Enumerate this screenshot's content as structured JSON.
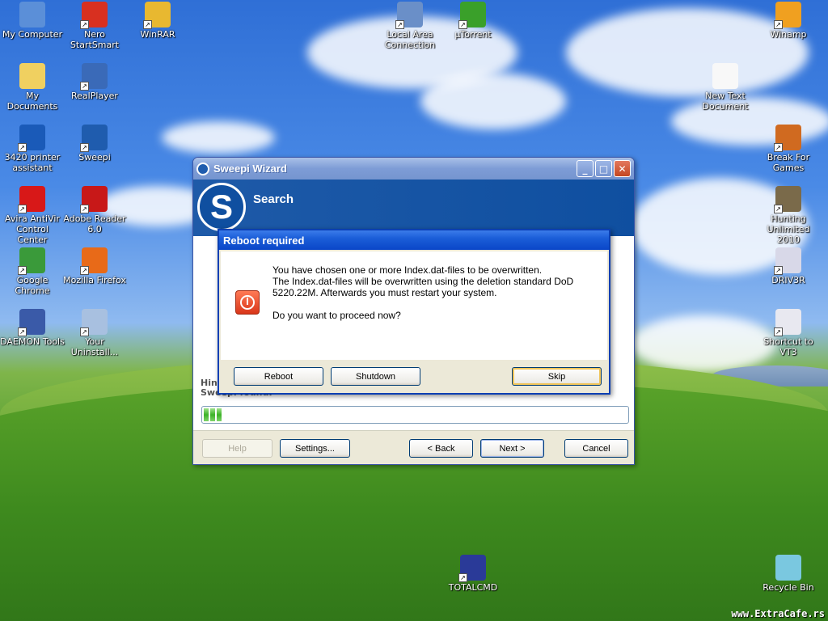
{
  "desktop": {
    "icons": [
      {
        "label": "My Computer",
        "glyph": "computer-icon",
        "color": "#5b8fd8"
      },
      {
        "label": "Nero StartSmart",
        "glyph": "nero-icon",
        "color": "#d83020"
      },
      {
        "label": "WinRAR",
        "glyph": "winrar-icon",
        "color": "#e8b830"
      },
      {
        "label": "Local Area Connection",
        "glyph": "network-icon",
        "color": "#6a8fc8"
      },
      {
        "label": "µTorrent",
        "glyph": "utorrent-icon",
        "color": "#3aa02a"
      },
      {
        "label": "Winamp",
        "glyph": "winamp-icon",
        "color": "#f0a020"
      },
      {
        "label": "My Documents",
        "glyph": "documents-icon",
        "color": "#f0d060"
      },
      {
        "label": "RealPlayer",
        "glyph": "realplayer-icon",
        "color": "#3a6ab8"
      },
      {
        "label": "New Text Document",
        "glyph": "text-document-icon",
        "color": "#f8f8f8"
      },
      {
        "label": "3420 printer assistant",
        "glyph": "hp-icon",
        "color": "#1a5ab8"
      },
      {
        "label": "Sweepi",
        "glyph": "sweepi-icon",
        "color": "#1f5cae"
      },
      {
        "label": "Break For Games",
        "glyph": "game-icon",
        "color": "#d06a20"
      },
      {
        "label": "Avira AntiVir Control Center",
        "glyph": "avira-icon",
        "color": "#d81818"
      },
      {
        "label": "Adobe Reader 6.0",
        "glyph": "adobe-icon",
        "color": "#c81818"
      },
      {
        "label": "Hunting Unlimited 2010",
        "glyph": "deer-icon",
        "color": "#7a6a4a"
      },
      {
        "label": "Google Chrome",
        "glyph": "chrome-icon",
        "color": "#3a9a3a"
      },
      {
        "label": "Mozilla Firefox",
        "glyph": "firefox-icon",
        "color": "#e86a18"
      },
      {
        "label": "DRIV3R",
        "glyph": "driver-icon",
        "color": "#d8d8e8"
      },
      {
        "label": "DAEMON Tools",
        "glyph": "daemon-icon",
        "color": "#3a5aa8"
      },
      {
        "label": "Your Uninstall...",
        "glyph": "trash-icon",
        "color": "#a8c0e0"
      },
      {
        "label": "Shortcut to VT3",
        "glyph": "window-icon",
        "color": "#e8e8f0"
      },
      {
        "label": "TOTALCMD",
        "glyph": "floppy-icon",
        "color": "#2a3a98"
      },
      {
        "label": "Recycle Bin",
        "glyph": "recycle-bin-icon",
        "color": "#7ac8e0"
      }
    ],
    "watermark": "www.ExtraCafe.rs"
  },
  "wizard": {
    "title": "Sweepi Wizard",
    "header_title": "Search",
    "logo_letter": "S",
    "hint_line1": "Hint",
    "hint_line2": "Sweepi found:",
    "progress_value": 0.05,
    "buttons": {
      "help": "Help",
      "settings": "Settings...",
      "back": "< Back",
      "next": "Next >",
      "cancel": "Cancel"
    },
    "title_buttons": {
      "minimize": "_",
      "maximize": "□",
      "close": "✕"
    }
  },
  "dialog": {
    "title": "Reboot required",
    "line1": "You have chosen one or more Index.dat-files to be overwritten.",
    "line2": "The Index.dat-files will be overwritten using the deletion standard DoD",
    "line3": "5220.22M. Afterwards you must restart your system.",
    "question": "Do you want to proceed now?",
    "buttons": {
      "reboot": "Reboot",
      "shutdown": "Shutdown",
      "skip": "Skip"
    }
  }
}
